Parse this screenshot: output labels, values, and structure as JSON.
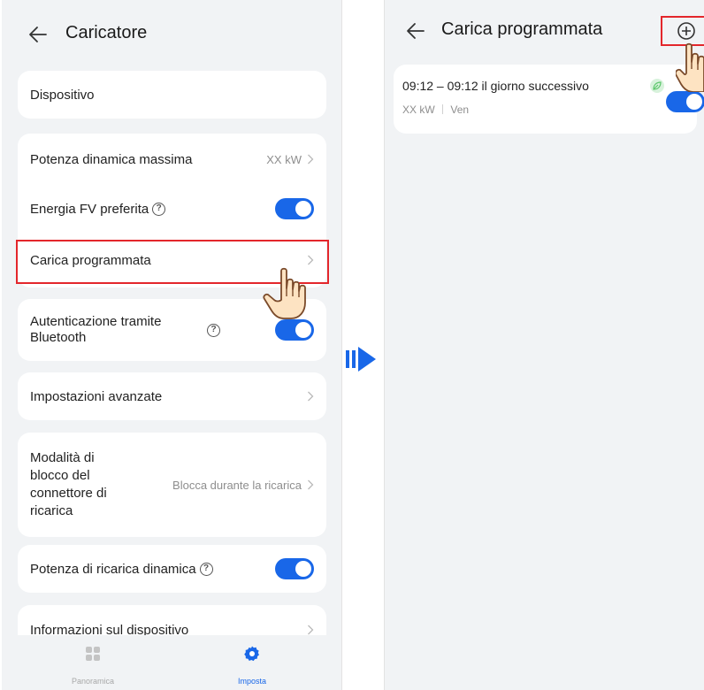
{
  "left_screen": {
    "title": "Caricatore",
    "items": {
      "device": {
        "label": "Dispositivo"
      },
      "max_dynamic_power": {
        "label": "Potenza dinamica massima",
        "value": "XX kW"
      },
      "preferred_pv": {
        "label": "Energia FV preferita",
        "toggle": true
      },
      "scheduled_charging": {
        "label": "Carica programmata"
      },
      "bluetooth_auth": {
        "label_line1": "Autenticazione tramite",
        "label_line2": "Bluetooth",
        "toggle": true
      },
      "advanced_settings": {
        "label": "Impostazioni avanzate"
      },
      "connector_lock": {
        "label_line1": "Modalità di",
        "label_line2": "blocco del",
        "label_line3": "connettore di",
        "label_line4": "ricarica",
        "value": "Blocca durante la ricarica"
      },
      "dynamic_charging_power": {
        "label": "Potenza di ricarica dinamica",
        "toggle": true
      },
      "device_info": {
        "label": "Informazioni sul dispositivo"
      }
    },
    "tabs": [
      {
        "label": "Panoramica",
        "active": false
      },
      {
        "label": "Imposta",
        "active": true
      }
    ]
  },
  "right_screen": {
    "title": "Carica programmata",
    "schedule": {
      "time": "09:12 – 09:12 il giorno successivo",
      "power": "XX kW",
      "days": "Ven",
      "enabled": true
    }
  },
  "colors": {
    "accent": "#1967e8",
    "highlight": "#e3262b",
    "background": "#f1f3f5",
    "leaf_green": "#5cc76b"
  },
  "icons": [
    "back-arrow-icon",
    "chevron-right-icon",
    "help-circle-icon",
    "grid-icon",
    "gear-icon",
    "plus-circle-icon",
    "leaf-icon",
    "pointing-hand-icon",
    "transition-arrow-icon"
  ]
}
